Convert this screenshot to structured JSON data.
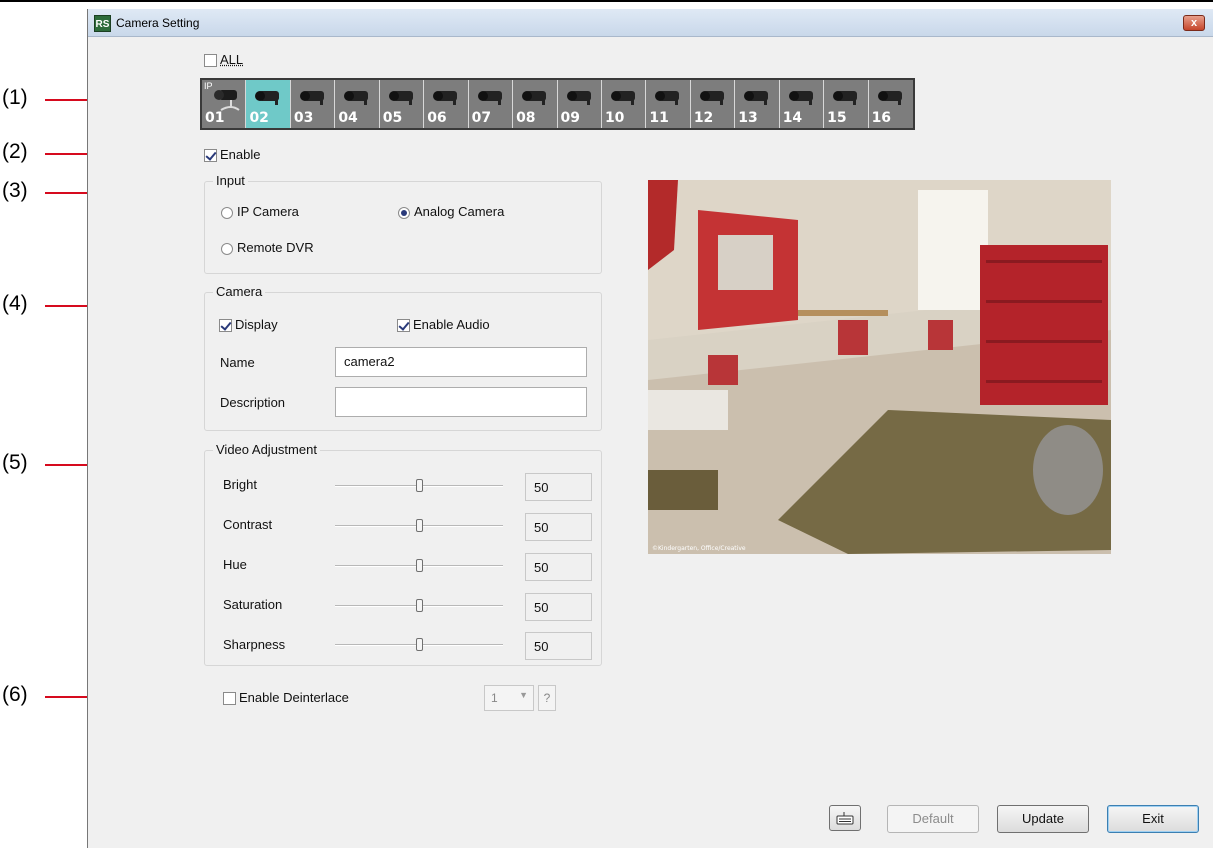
{
  "window": {
    "title": "Camera Setting",
    "close_glyph": "x"
  },
  "callouts": [
    "(1)",
    "(2)",
    "(3)",
    "(4)",
    "(5)",
    "(6)"
  ],
  "all_checkbox": {
    "label": "ALL",
    "checked": false
  },
  "camera_strip": {
    "ip_tag": "IP",
    "selected": "02",
    "cameras": [
      "01",
      "02",
      "03",
      "04",
      "05",
      "06",
      "07",
      "08",
      "09",
      "10",
      "11",
      "12",
      "13",
      "14",
      "15",
      "16"
    ]
  },
  "enable_checkbox": {
    "label": "Enable",
    "checked": true
  },
  "input_group": {
    "title": "Input",
    "options": {
      "ip_camera": "IP Camera",
      "analog_camera": "Analog Camera",
      "remote_dvr": "Remote DVR"
    },
    "selected": "Analog Camera"
  },
  "camera_group": {
    "title": "Camera",
    "display_label": "Display",
    "enable_audio_label": "Enable Audio",
    "name_label": "Name",
    "name_value": "camera2",
    "description_label": "Description",
    "description_value": ""
  },
  "video_adjustment": {
    "title": "Video Adjustment",
    "bright": {
      "label": "Bright",
      "value": "50"
    },
    "contrast": {
      "label": "Contrast",
      "value": "50"
    },
    "hue": {
      "label": "Hue",
      "value": "50"
    },
    "saturation": {
      "label": "Saturation",
      "value": "50"
    },
    "sharpness": {
      "label": "Sharpness",
      "value": "50"
    }
  },
  "deinterlace": {
    "label": "Enable Deinterlace",
    "checked": false,
    "select_value": "1",
    "help_label": "?"
  },
  "preview": {
    "watermark": "©Kindergarten, Office/Creative"
  },
  "buttons": {
    "default": "Default",
    "update": "Update",
    "exit": "Exit",
    "keyboard_icon": "keyboard-icon"
  },
  "colors": {
    "selected_camera": "#6fc9c8",
    "callout_line": "#d60a1e",
    "window_bg": "#f0f0f0"
  }
}
